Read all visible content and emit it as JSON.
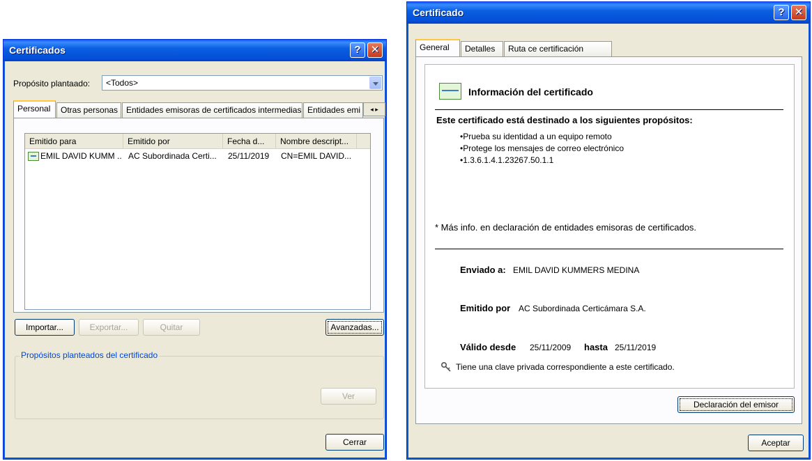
{
  "left_window": {
    "title": "Certificados",
    "help_glyph": "?",
    "close_glyph": "✕",
    "purpose_label": "Propósito plantaado:",
    "purpose_value": "<Todos>",
    "tabs": [
      "Personal",
      "Otras personas",
      "Entidades emisoras de certificados intermedias",
      "Entidades emi"
    ],
    "tab_scroll_left": "◂",
    "tab_scroll_right": "▸",
    "columns": [
      "Emitido para",
      "Emitido por",
      "Fecha d...",
      "Nombre descript..."
    ],
    "rows": [
      {
        "issued_to": "EMIL DAVID KUMM ..",
        "issued_by": "AC Subordinada Certi...",
        "date": "25/11/2019",
        "friendly_name": "CN=EMIL DAVID..."
      }
    ],
    "buttons": {
      "import": "Importar...",
      "export": "Exportar...",
      "remove": "Quitar",
      "advanced": "Avanzadas...",
      "view": "Ver",
      "close": "Cerrar"
    },
    "purposes_group_label": "Propósitos planteados del certificado"
  },
  "right_window": {
    "title": "Certificado",
    "help_glyph": "?",
    "close_glyph": "✕",
    "tabs": [
      "General",
      "Detalles",
      "Ruta ce certificación"
    ],
    "info_title": "Información del certificado",
    "purposes_heading": "Este certificado está destinado a los siguientes propósitos:",
    "purposes": [
      "•Prueba su identidad a un equipo remoto",
      "•Protege los mensajes de correo electrónico",
      "•1.3.6.1.4.1.23267.50.1.1"
    ],
    "more_info": "* Más info. en declaración de entidades emisoras de certificados.",
    "sent_to_label": "Enviado a:",
    "sent_to_value": "EMIL DAVID KUMMERS MEDINA",
    "issued_by_label": "Emitido por",
    "issued_by_value": "AC Subordinada Certicámara S.A.",
    "valid_from_label": "Válido desde",
    "valid_from_value": "25/11/2009",
    "valid_to_label": "hasta",
    "valid_to_value": "25/11/2019",
    "private_key_note": "Tiene una clave privada correspondiente a este certificado.",
    "buttons": {
      "issuer_statement": "Declaración del emisor",
      "accept": "Aceptar"
    }
  }
}
